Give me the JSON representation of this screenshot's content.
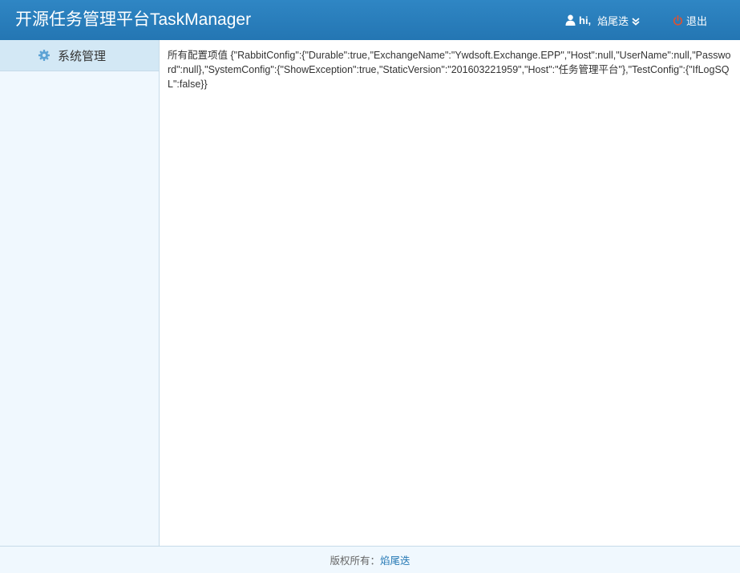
{
  "header": {
    "brand": "开源任务管理平台TaskManager",
    "user": {
      "greeting": "hi,",
      "name": "焰尾迭",
      "icon": "user-icon",
      "dropdown_icon": "double-chevron-down-icon"
    },
    "logout": {
      "label": "退出",
      "icon": "power-icon",
      "icon_color": "#e4502c"
    }
  },
  "sidebar": {
    "items": [
      {
        "label": "系统管理",
        "icon": "gear-icon",
        "icon_color": "#5da3d5",
        "active": true
      }
    ]
  },
  "main": {
    "label": "所有配置项值",
    "config_json": "{\"RabbitConfig\":{\"Durable\":true,\"ExchangeName\":\"Ywdsoft.Exchange.EPP\",\"Host\":null,\"UserName\":null,\"Password\":null},\"SystemConfig\":{\"ShowException\":true,\"StaticVersion\":\"201603221959\",\"Host\":\"任务管理平台\"},\"TestConfig\":{\"IfLogSQL\":false}}"
  },
  "footer": {
    "copyright_label": "版权所有：",
    "owner": "焰尾迭"
  },
  "colors": {
    "header_bg": "#2a7fbe",
    "sidebar_bg": "#f0f8fe",
    "sidebar_active_bg": "#d3e8f5",
    "link": "#2679b5"
  }
}
